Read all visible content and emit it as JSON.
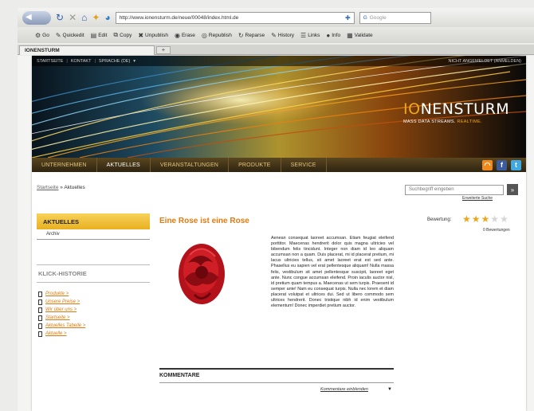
{
  "browser": {
    "url": "http://www.ionensturm.de/neue/00048/index.html.de",
    "search_placeholder": "Google",
    "bookmarks": [
      {
        "label": "Go",
        "icon": "gear-icon",
        "glyph": "⚙"
      },
      {
        "label": "Quickedit",
        "icon": "pencil-icon",
        "glyph": "✎"
      },
      {
        "label": "Edit",
        "icon": "edit-icon",
        "glyph": "▤"
      },
      {
        "label": "Copy",
        "icon": "copy-icon",
        "glyph": "⧉"
      },
      {
        "label": "Unpublish",
        "icon": "cross-icon",
        "glyph": "✖"
      },
      {
        "label": "Erase",
        "icon": "erase-icon",
        "glyph": "◉"
      },
      {
        "label": "Republish",
        "icon": "republish-icon",
        "glyph": "◎"
      },
      {
        "label": "Reparse",
        "icon": "reparse-icon",
        "glyph": "↻"
      },
      {
        "label": "History",
        "icon": "history-icon",
        "glyph": "✎"
      },
      {
        "label": "Links",
        "icon": "links-icon",
        "glyph": "☰"
      },
      {
        "label": "Info",
        "icon": "info-icon",
        "glyph": "●"
      },
      {
        "label": "Validate",
        "icon": "validate-icon",
        "glyph": "▦"
      }
    ],
    "tab_title": "IONENSTURM",
    "newtab_label": "+"
  },
  "site": {
    "topbar": {
      "links": [
        "STARTSEITE",
        "KONTAKT",
        "SPRACHE (DE)"
      ],
      "login": "NICHT ANGEMELDET (ANMELDEN)"
    },
    "logo": {
      "part1": "IO",
      "part2": "NENSTURM"
    },
    "tagline": {
      "main": "MASS DATA STREAMS.",
      "highlight": "REALTIME."
    },
    "nav": [
      {
        "label": "UNTERNEHMEN",
        "active": false
      },
      {
        "label": "AKTUELLES",
        "active": true
      },
      {
        "label": "VERANSTALTUNGEN",
        "active": false
      },
      {
        "label": "PRODUKTE",
        "active": false
      },
      {
        "label": "SERVICE",
        "active": false
      }
    ],
    "breadcrumb": {
      "home": "Startseite",
      "separator": " » ",
      "current": "Aktuelles"
    },
    "search": {
      "placeholder": "Suchbegriff eingeben",
      "button": "»",
      "advanced": "Erweiterte Suche"
    },
    "sidebar": {
      "section_title": "AKTUELLES",
      "item": "Archiv",
      "history_title": "KLICK-HISTORIE",
      "history": [
        "Produkte >",
        "Unsere Preise >",
        "Wir über uns >",
        "Startseite >",
        "Aktuelles Tabelle >",
        "Aktuelle >"
      ]
    },
    "article": {
      "title": "Eine Rose ist eine Rose",
      "rating_label": "Bewertung:",
      "rating": 3,
      "rating_max": 5,
      "rating_count": "0 Bewertungen",
      "text": "Aenean consequat laoreet accumsan. Etiam feugiat eleifend porttitor. Maecenas hendrerit dolor quis magna ultricies vel bibendum felis tincidunt. Integer non diam id leo aliquam accumsan non a quam. Duis placerat, mi id placerat pretium, mi lacus ultricies tellus, sit amet laoreet erat est sed ante. Phasellus eu sapien vel erat pellentesque aliquam! Nulla massa felis, vestibulum sit amet pellentesque suscipit, laoreet eget ante. Nunc congue accumsan eleifend. Proin iaculis auctor nisl, id pretium quam tempus a. Maecenas ut sem turpis. Praesent id semper ante! Nam eu consequat turpis. Nulla nec lorem et diam placerat volutpat et ultrices dui. Sed ut libero commodo sem ultrices hendrerit. Donec tristique nibh id enim vestibulum elementum! Donec imperdiet pretium auctor.",
      "comments_title": "KOMMENTARE",
      "comments_link": "Kommentare einblenden"
    },
    "social": [
      "rss-icon",
      "facebook-icon",
      "twitter-icon"
    ]
  },
  "colors": {
    "accent": "#e07b10",
    "gold": "#f2a61c",
    "nav_bg": "#3a2e16"
  }
}
